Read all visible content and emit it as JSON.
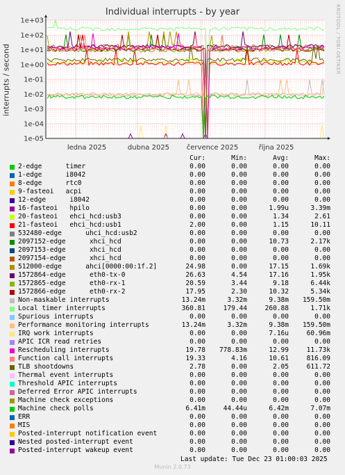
{
  "chart_data": {
    "type": "line",
    "title": "Individual interrupts - by year",
    "ylabel": "interrupts / second",
    "yscale": "log",
    "ylim": [
      1e-05,
      1000
    ],
    "yticks": [
      "1e+03",
      "1e+02",
      "1e+01",
      "1e+00",
      "1e-01",
      "1e-02",
      "1e-03",
      "1e-04",
      "1e-05"
    ],
    "xticks": [
      "ledna 2025",
      "dubna 2025",
      "července 2025",
      "října 2025"
    ],
    "grid": true,
    "columns": [
      "Cur:",
      "Min:",
      "Avg:",
      "Max:"
    ],
    "series": [
      {
        "name": "2-edge      timer",
        "color": "#00cc00",
        "cur": "0.00",
        "min": "0.00",
        "avg": "0.00",
        "max": "0.00"
      },
      {
        "name": "1-edge      i8042",
        "color": "#0066b3",
        "cur": "0.00",
        "min": "0.00",
        "avg": "0.00",
        "max": "0.00"
      },
      {
        "name": "8-edge      rtc0",
        "color": "#ff8000",
        "cur": "0.00",
        "min": "0.00",
        "avg": "0.00",
        "max": "0.00"
      },
      {
        "name": "9-fasteoi   acpi",
        "color": "#ffcc00",
        "cur": "0.00",
        "min": "0.00",
        "avg": "0.00",
        "max": "0.00"
      },
      {
        "name": "12-edge      i8042",
        "color": "#330099",
        "cur": "0.00",
        "min": "0.00",
        "avg": "0.00",
        "max": "0.00"
      },
      {
        "name": "16-fasteoi   hpilo",
        "color": "#990099",
        "cur": "0.00",
        "min": "0.00",
        "avg": "1.99u",
        "max": "3.39m"
      },
      {
        "name": "20-fasteoi   ehci_hcd:usb3",
        "color": "#ccff00",
        "cur": "0.00",
        "min": "0.00",
        "avg": "1.34",
        "max": "2.61"
      },
      {
        "name": "21-fasteoi   ehci_hcd:usb1",
        "color": "#ff0000",
        "cur": "2.00",
        "min": "0.00",
        "avg": "1.15",
        "max": "10.11"
      },
      {
        "name": "532480-edge      uhci_hcd:usb2",
        "color": "#808080",
        "cur": "0.00",
        "min": "0.00",
        "avg": "0.00",
        "max": "0.00"
      },
      {
        "name": "2097152-edge      xhci_hcd",
        "color": "#008f00",
        "cur": "0.00",
        "min": "0.00",
        "avg": "10.73",
        "max": "2.17k"
      },
      {
        "name": "2097153-edge      xhci_hcd",
        "color": "#00487d",
        "cur": "0.00",
        "min": "0.00",
        "avg": "0.00",
        "max": "0.00"
      },
      {
        "name": "2097154-edge      xhci_hcd",
        "color": "#b35a00",
        "cur": "0.00",
        "min": "0.00",
        "avg": "0.00",
        "max": "0.00"
      },
      {
        "name": "512000-edge      ahci[0000:00:1f.2]",
        "color": "#b38f00",
        "cur": "24.98",
        "min": "0.00",
        "avg": "17.15",
        "max": "1.69k"
      },
      {
        "name": "1572864-edge      eth0-tx-0",
        "color": "#6b006b",
        "cur": "26.63",
        "min": "4.54",
        "avg": "17.16",
        "max": "1.95k"
      },
      {
        "name": "1572865-edge      eth0-rx-1",
        "color": "#8fb300",
        "cur": "20.59",
        "min": "3.44",
        "avg": "9.18",
        "max": "6.44k"
      },
      {
        "name": "1572866-edge      eth0-rx-2",
        "color": "#b30000",
        "cur": "17.95",
        "min": "2.30",
        "avg": "10.32",
        "max": "5.34k"
      },
      {
        "name": "Non-maskable interrupts",
        "color": "#bebebe",
        "cur": "13.24m",
        "min": "3.32m",
        "avg": "9.38m",
        "max": "159.50m"
      },
      {
        "name": "Local timer interrupts",
        "color": "#80ff80",
        "cur": "360.81",
        "min": "179.44",
        "avg": "260.88",
        "max": "1.71k"
      },
      {
        "name": "Spurious interrupts",
        "color": "#80c9ff",
        "cur": "0.00",
        "min": "0.00",
        "avg": "0.00",
        "max": "0.00"
      },
      {
        "name": "Performance monitoring interrupts",
        "color": "#ffc080",
        "cur": "13.24m",
        "min": "3.32m",
        "avg": "9.38m",
        "max": "159.50m"
      },
      {
        "name": "IRQ work interrupts",
        "color": "#ffe680",
        "cur": "0.00",
        "min": "0.00",
        "avg": "7.16u",
        "max": "60.96m"
      },
      {
        "name": "APIC ICR read retries",
        "color": "#aa80ff",
        "cur": "0.00",
        "min": "0.00",
        "avg": "0.00",
        "max": "0.00"
      },
      {
        "name": "Rescheduling interrupts",
        "color": "#ee00cc",
        "cur": "19.78",
        "min": "778.83m",
        "avg": "12.99",
        "max": "11.73k"
      },
      {
        "name": "Function call interrupts",
        "color": "#ff8080",
        "cur": "19.33",
        "min": "4.16",
        "avg": "10.61",
        "max": "816.09"
      },
      {
        "name": "TLB shootdowns",
        "color": "#666600",
        "cur": "2.78",
        "min": "0.00",
        "avg": "2.05",
        "max": "611.72"
      },
      {
        "name": "Thermal event interrupts",
        "color": "#ffbfff",
        "cur": "0.00",
        "min": "0.00",
        "avg": "0.00",
        "max": "0.00"
      },
      {
        "name": "Threshold APIC interrupts",
        "color": "#00ffcc",
        "cur": "0.00",
        "min": "0.00",
        "avg": "0.00",
        "max": "0.00"
      },
      {
        "name": "Deferred Error APIC interrupts",
        "color": "#cc6699",
        "cur": "0.00",
        "min": "0.00",
        "avg": "0.00",
        "max": "0.00"
      },
      {
        "name": "Machine check exceptions",
        "color": "#999900",
        "cur": "0.00",
        "min": "0.00",
        "avg": "0.00",
        "max": "0.00"
      },
      {
        "name": "Machine check polls",
        "color": "#00cc00",
        "cur": "6.41m",
        "min": "44.44u",
        "avg": "6.42m",
        "max": "7.07m"
      },
      {
        "name": "ERR",
        "color": "#0066b3",
        "cur": "0.00",
        "min": "0.00",
        "avg": "0.00",
        "max": "0.00"
      },
      {
        "name": "MIS",
        "color": "#ff8000",
        "cur": "0.00",
        "min": "0.00",
        "avg": "0.00",
        "max": "0.00"
      },
      {
        "name": "Posted-interrupt notification event",
        "color": "#ffcc00",
        "cur": "0.00",
        "min": "0.00",
        "avg": "0.00",
        "max": "0.00"
      },
      {
        "name": "Nested posted-interrupt event",
        "color": "#330099",
        "cur": "0.00",
        "min": "0.00",
        "avg": "0.00",
        "max": "0.00"
      },
      {
        "name": "Posted-interrupt wakeup event",
        "color": "#990099",
        "cur": "0.00",
        "min": "0.00",
        "avg": "0.00",
        "max": "0.00"
      }
    ]
  },
  "side_label": "RRDTOOL / TOBI OETIKER",
  "footer": {
    "last_update": "Last update: Tue Dec 23 01:00:03 2025",
    "munin": "Munin 2.0.73"
  }
}
